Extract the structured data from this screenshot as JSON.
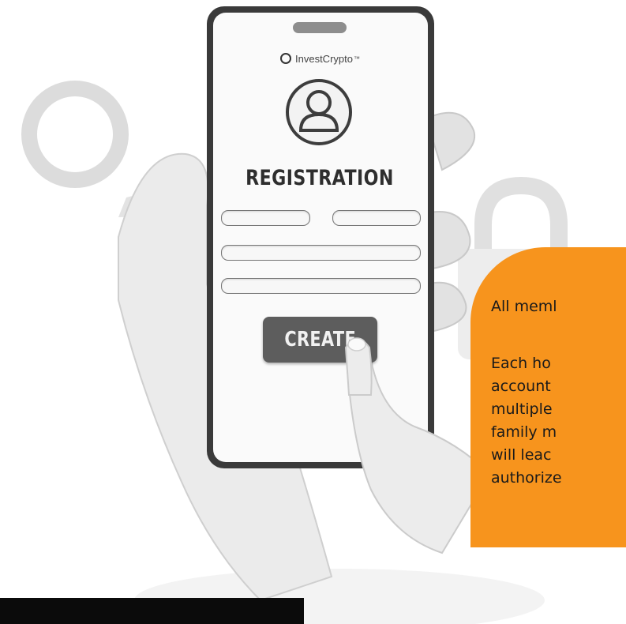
{
  "phone": {
    "brand_name": "InvestCrypto",
    "brand_mark": "™",
    "title": "REGISTRATION",
    "create_label": "CREATE"
  },
  "info_card": {
    "color": "#f7941d",
    "lines": [
      "All meml",
      "Each ho",
      "account",
      "multiple",
      "family m",
      "will  leac",
      "authorize"
    ]
  },
  "icons": [
    "user-avatar-icon",
    "crypto-logo-icon",
    "lock-icon",
    "user-outline-icon"
  ]
}
